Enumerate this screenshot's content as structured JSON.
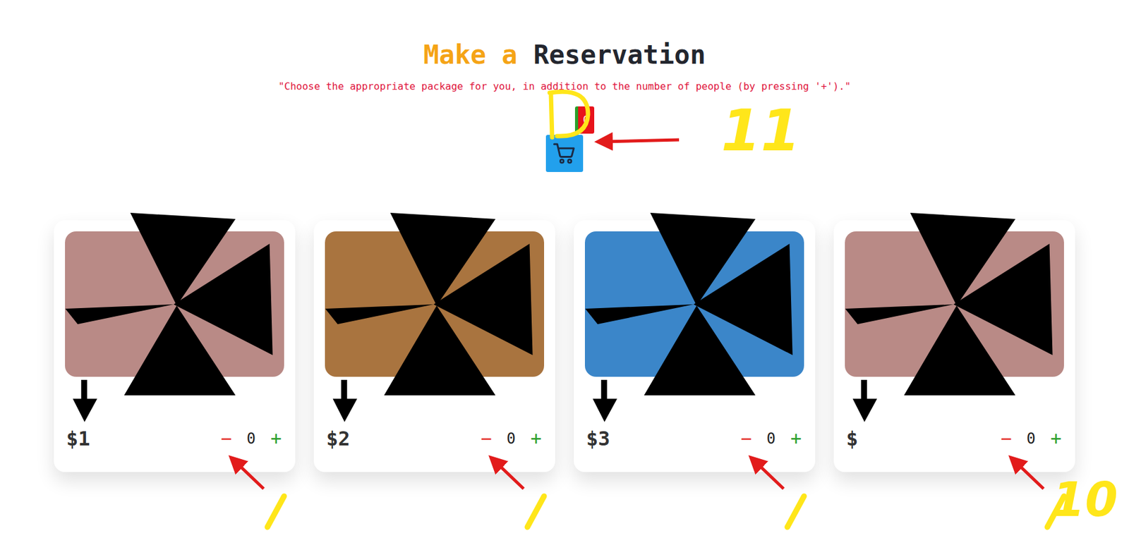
{
  "page": {
    "heading_first": "Make a",
    "heading_second": "Reservation",
    "instruction": "\"Choose the appropriate package for you, in addition to the number of people (by pressing '+').\""
  },
  "cart": {
    "count": "0"
  },
  "controls": {
    "minus": "−",
    "plus": "+"
  },
  "packages": [
    {
      "price": "$1",
      "quantity": "0",
      "color": "#b98a86"
    },
    {
      "price": "$2",
      "quantity": "0",
      "color": "#a9743f"
    },
    {
      "price": "$3",
      "quantity": "0",
      "color": "#3b86c9"
    },
    {
      "price": "$",
      "quantity": "0",
      "color": "#b98a86"
    }
  ],
  "annotations": {
    "labels": [
      "11",
      "10"
    ]
  }
}
